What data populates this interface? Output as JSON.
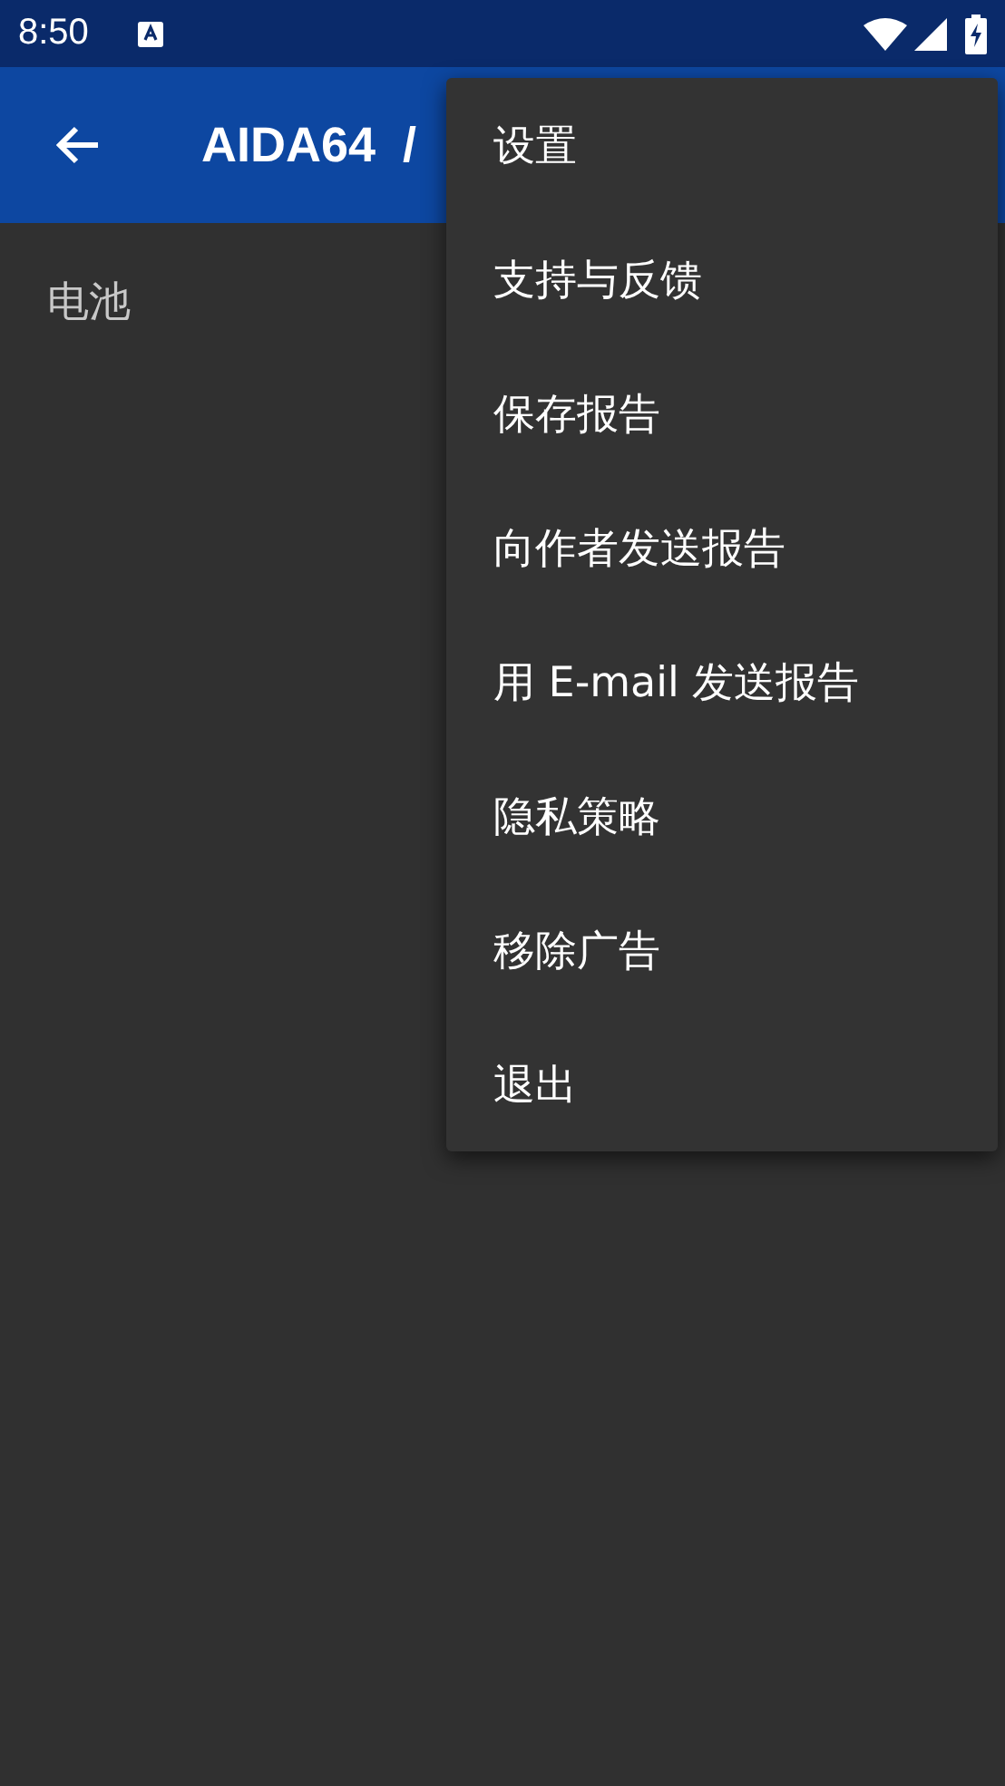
{
  "status_bar": {
    "time": "8:50"
  },
  "app_bar": {
    "title": "AIDA64  /"
  },
  "content": {
    "section_label": "电池"
  },
  "menu": {
    "items": [
      {
        "label": "设置"
      },
      {
        "label": "支持与反馈"
      },
      {
        "label": "保存报告"
      },
      {
        "label": "向作者发送报告"
      },
      {
        "label": "用 E-mail 发送报告"
      },
      {
        "label": "隐私策略"
      },
      {
        "label": "移除广告"
      },
      {
        "label": "退出"
      }
    ]
  }
}
